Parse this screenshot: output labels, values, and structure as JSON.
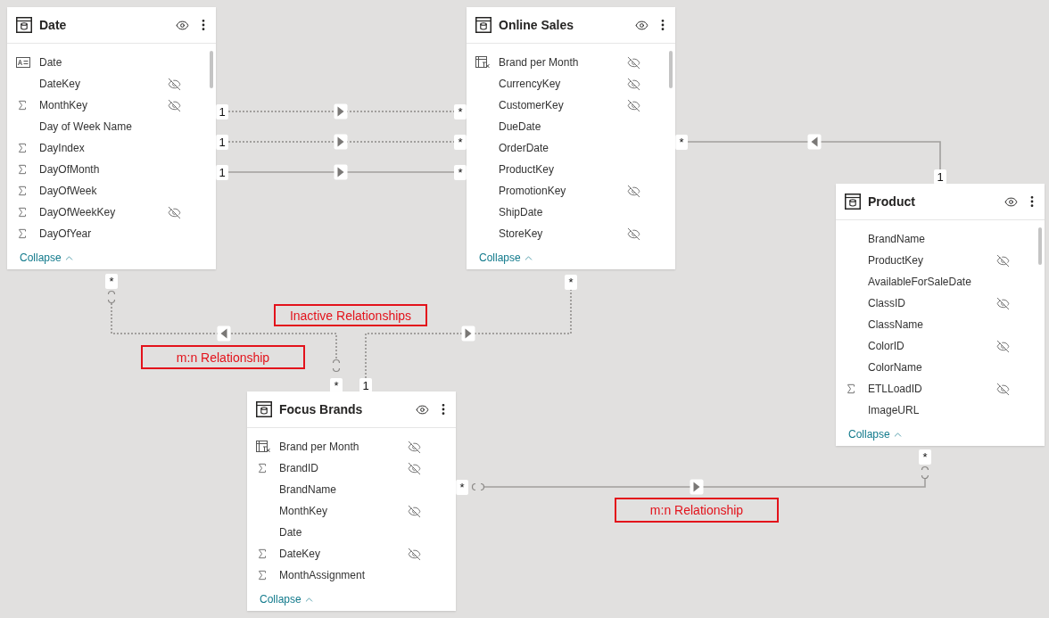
{
  "tables": [
    {
      "title": "Date",
      "scrollable": true,
      "collapse": "Collapse",
      "fields": [
        {
          "name": "Date",
          "kind": "text",
          "hidden": false
        },
        {
          "name": "DateKey",
          "kind": "plain",
          "hidden": true
        },
        {
          "name": "MonthKey",
          "kind": "sum",
          "hidden": true
        },
        {
          "name": "Day of Week Name",
          "kind": "plain",
          "hidden": false
        },
        {
          "name": "DayIndex",
          "kind": "sum",
          "hidden": false
        },
        {
          "name": "DayOfMonth",
          "kind": "sum",
          "hidden": false
        },
        {
          "name": "DayOfWeek",
          "kind": "sum",
          "hidden": false
        },
        {
          "name": "DayOfWeekKey",
          "kind": "sum",
          "hidden": true
        },
        {
          "name": "DayOfYear",
          "kind": "sum",
          "hidden": false
        }
      ]
    },
    {
      "title": "Online Sales",
      "scrollable": true,
      "collapse": "Collapse",
      "fields": [
        {
          "name": "Brand per Month",
          "kind": "calc",
          "hidden": true
        },
        {
          "name": "CurrencyKey",
          "kind": "plain",
          "hidden": true
        },
        {
          "name": "CustomerKey",
          "kind": "plain",
          "hidden": true
        },
        {
          "name": "DueDate",
          "kind": "plain",
          "hidden": false
        },
        {
          "name": "OrderDate",
          "kind": "plain",
          "hidden": false
        },
        {
          "name": "ProductKey",
          "kind": "plain",
          "hidden": false
        },
        {
          "name": "PromotionKey",
          "kind": "plain",
          "hidden": true
        },
        {
          "name": "ShipDate",
          "kind": "plain",
          "hidden": false
        },
        {
          "name": "StoreKey",
          "kind": "plain",
          "hidden": true
        }
      ]
    },
    {
      "title": "Product",
      "scrollable": true,
      "collapse": "Collapse",
      "fields": [
        {
          "name": "BrandName",
          "kind": "plain",
          "hidden": false
        },
        {
          "name": "ProductKey",
          "kind": "plain",
          "hidden": true
        },
        {
          "name": "AvailableForSaleDate",
          "kind": "plain",
          "hidden": false
        },
        {
          "name": "ClassID",
          "kind": "plain",
          "hidden": true
        },
        {
          "name": "ClassName",
          "kind": "plain",
          "hidden": false
        },
        {
          "name": "ColorID",
          "kind": "plain",
          "hidden": true
        },
        {
          "name": "ColorName",
          "kind": "plain",
          "hidden": false
        },
        {
          "name": "ETLLoadID",
          "kind": "sum",
          "hidden": true
        },
        {
          "name": "ImageURL",
          "kind": "plain",
          "hidden": false
        }
      ]
    },
    {
      "title": "Focus Brands",
      "scrollable": false,
      "collapse": "Collapse",
      "fields": [
        {
          "name": "Brand per Month",
          "kind": "calc",
          "hidden": true
        },
        {
          "name": "BrandID",
          "kind": "sum",
          "hidden": true
        },
        {
          "name": "BrandName",
          "kind": "plain",
          "hidden": false
        },
        {
          "name": "MonthKey",
          "kind": "plain",
          "hidden": true
        },
        {
          "name": "Date",
          "kind": "plain",
          "hidden": false
        },
        {
          "name": "DateKey",
          "kind": "sum",
          "hidden": true
        },
        {
          "name": "MonthAssignment",
          "kind": "sum",
          "hidden": false
        }
      ]
    }
  ],
  "relationships": [
    {
      "from_end": "1",
      "to_end": "*",
      "dotted": true,
      "points_right": true
    },
    {
      "from_end": "1",
      "to_end": "*",
      "dotted": true,
      "points_right": true
    },
    {
      "from_end": "1",
      "to_end": "*",
      "dotted": false,
      "points_right": true
    },
    {
      "from_end": "*",
      "to_end": "1",
      "dotted": false,
      "points_right": false
    },
    {
      "from_end": "*",
      "to_end": "*",
      "dotted": true,
      "points_right": false,
      "circles": true
    },
    {
      "from_end": "1",
      "to_end": "*",
      "dotted": true,
      "points_right": true
    },
    {
      "from_end": "*",
      "to_end": "*",
      "dotted": false,
      "points_right": true,
      "circles": true
    }
  ],
  "annotations": [
    "Inactive Relationships",
    "m:n Relationship",
    "m:n Relationship"
  ]
}
